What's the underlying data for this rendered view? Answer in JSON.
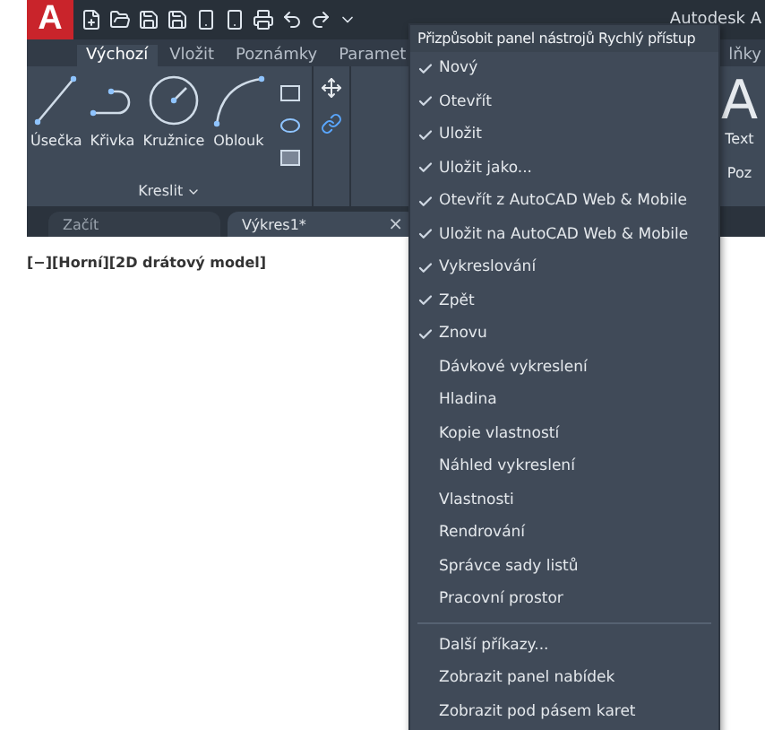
{
  "window": {
    "title": "Autodesk A"
  },
  "logo": "A",
  "ribbon_tabs": [
    {
      "label": "Výchozí",
      "selected": true
    },
    {
      "label": "Vložit",
      "selected": false
    },
    {
      "label": "Poznámky",
      "selected": false
    },
    {
      "label": "Paramet",
      "selected": false
    },
    {
      "label": "lňky",
      "selected": false
    }
  ],
  "draw_panel": {
    "tools": [
      {
        "label": "Úsečka",
        "kind": "line"
      },
      {
        "label": "Křivka",
        "kind": "polyline"
      },
      {
        "label": "Kružnice",
        "kind": "circle"
      },
      {
        "label": "Oblouk",
        "kind": "arc"
      }
    ],
    "title": "Kreslit"
  },
  "text_panel": {
    "letter": "A",
    "label": "Text",
    "title": "Poz"
  },
  "file_tabs": [
    {
      "label": "Začít",
      "selected": false
    },
    {
      "label": "Výkres1*",
      "selected": true
    }
  ],
  "close_tab": "×",
  "viewport_label": "[−][Horní][2D drátový model]",
  "menu": {
    "title": "Přizpůsobit panel nástrojů Rychlý přístup",
    "items": [
      {
        "label": "Nový",
        "checked": true
      },
      {
        "label": "Otevřít",
        "checked": true
      },
      {
        "label": "Uložit",
        "checked": true
      },
      {
        "label": "Uložit jako...",
        "checked": true
      },
      {
        "label": "Otevřít z AutoCAD Web & Mobile",
        "checked": true
      },
      {
        "label": "Uložit na AutoCAD Web & Mobile",
        "checked": true
      },
      {
        "label": "Vykreslování",
        "checked": true
      },
      {
        "label": "Zpět",
        "checked": true
      },
      {
        "label": "Znovu",
        "checked": true
      },
      {
        "label": "Dávkové vykreslení",
        "checked": false
      },
      {
        "label": "Hladina",
        "checked": false
      },
      {
        "label": "Kopie vlastností",
        "checked": false
      },
      {
        "label": "Náhled vykreslení",
        "checked": false
      },
      {
        "label": "Vlastnosti",
        "checked": false
      },
      {
        "label": "Rendrování",
        "checked": false
      },
      {
        "label": "Správce sady listů",
        "checked": false
      },
      {
        "label": "Pracovní prostor",
        "checked": false
      }
    ],
    "extra": [
      "Další příkazy...",
      "Zobrazit panel nabídek",
      "Zobrazit pod pásem karet"
    ]
  }
}
